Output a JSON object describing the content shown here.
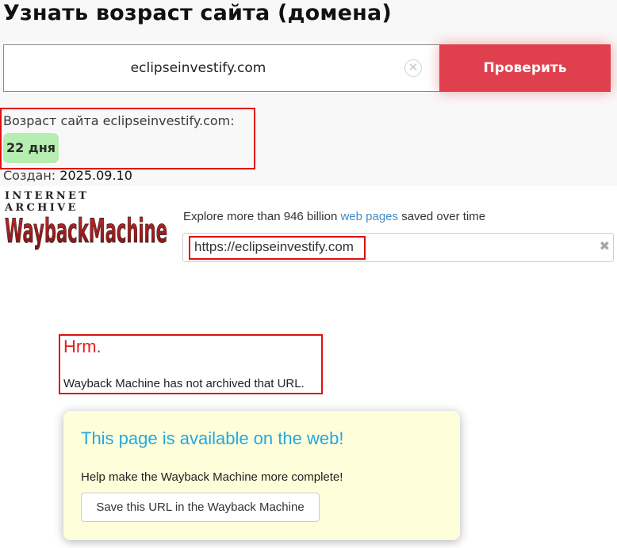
{
  "age_tool": {
    "title": "Узнать возраст сайта (домена)",
    "domain_value": "eclipseinvestify.com",
    "clear_symbol": "✕",
    "check_label": "Проверить",
    "age_label": "Возраст сайта eclipseinvestify.com:",
    "age_value": "22 дня",
    "created_label": "Создан:",
    "created_value": "2025.09.10",
    "colors": {
      "button": "#e0404e",
      "badge": "#b6edb1",
      "highlight": "#e01010"
    }
  },
  "wayback": {
    "logo_top": "INTERNET ARCHIVE",
    "logo_main": "WaybackMachine",
    "explore_prefix": "Explore more than 946 billion",
    "explore_link": "web pages",
    "explore_suffix": "saved over time",
    "url_value": "https://eclipseinvestify.com",
    "clear_symbol": "✖",
    "error_title": "Hrm.",
    "error_message": "Wayback Machine has not archived that URL.",
    "available_title": "This page is available on the web!",
    "available_help": "Help make the Wayback Machine more complete!",
    "save_button": "Save this URL in the Wayback Machine",
    "colors": {
      "link": "#428bca",
      "error": "#e02020",
      "available": "#21a9e1",
      "logo": "#a51c1c"
    }
  }
}
